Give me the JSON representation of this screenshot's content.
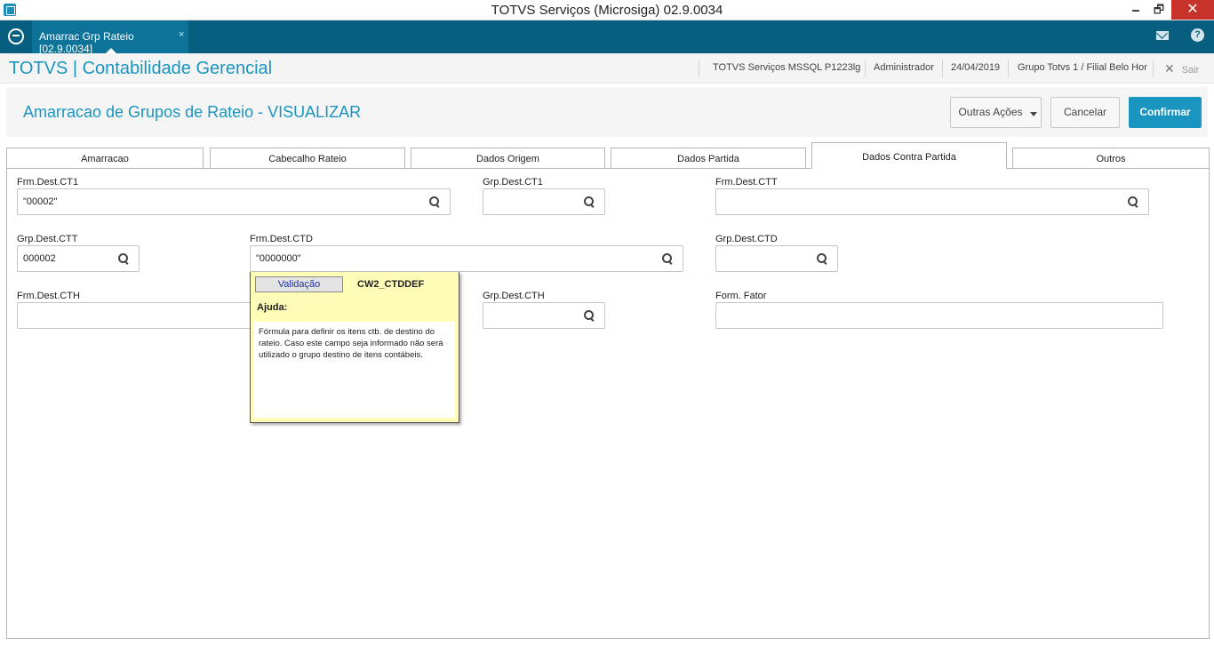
{
  "window": {
    "title": "TOTVS Serviços (Microsiga) 02.9.0034",
    "minimize": "🗕",
    "maximize": "🗗",
    "close": "✕"
  },
  "tabstrip": {
    "app_tab": "Amarrac Grp Rateio [02.9.0034]",
    "close_glyph": "×",
    "help_glyph": "?"
  },
  "module": {
    "title": "TOTVS | Contabilidade Gerencial",
    "environment": "TOTVS Serviços MSSQL P1223lg",
    "user": "Administrador",
    "date": "24/04/2019",
    "branch": "Grupo Totvs 1 / Filial Belo Hor",
    "exit_icon": "✕",
    "exit": "Sair"
  },
  "page": {
    "title": "Amarracao de Grupos de Rateio - VISUALIZAR",
    "other_actions": "Outras Ações",
    "cancel": "Cancelar",
    "confirm": "Confirmar"
  },
  "tabs": [
    "Amarracao",
    "Cabecalho Rateio",
    "Dados Origem",
    "Dados Partida",
    "Dados Contra Partida",
    "Outros"
  ],
  "active_tab": "Dados Contra Partida",
  "fields": {
    "frm_dest_ct1": {
      "label": "Frm.Dest.CT1",
      "value": "\"00002\""
    },
    "grp_dest_ct1": {
      "label": "Grp.Dest.CT1",
      "value": ""
    },
    "frm_dest_ctt": {
      "label": "Frm.Dest.CTT",
      "value": ""
    },
    "grp_dest_ctt": {
      "label": "Grp.Dest.CTT",
      "value": "000002"
    },
    "frm_dest_ctd": {
      "label": "Frm.Dest.CTD",
      "value": "\"0000000\""
    },
    "grp_dest_ctd": {
      "label": "Grp.Dest.CTD",
      "value": ""
    },
    "frm_dest_cth": {
      "label": "Frm.Dest.CTH",
      "value": ""
    },
    "grp_dest_cth": {
      "label": "Grp.Dest.CTH",
      "value": ""
    },
    "form_fator": {
      "label": "Form. Fator",
      "value": ""
    }
  },
  "help_tooltip": {
    "validation_button": "Validação",
    "field_code": "CW2_CTDDEF",
    "help_title": "Ajuda:",
    "help_text": "Fórmula para definir os itens ctb. de destino do rateio. Caso este campo seja informado não será utilizado o grupo destino de itens contábeis."
  },
  "colors": {
    "brand": "#1a95c0",
    "tabstrip": "#075e7e",
    "tooltip_bg": "#fffcb7",
    "close_button": "#c7322a"
  }
}
